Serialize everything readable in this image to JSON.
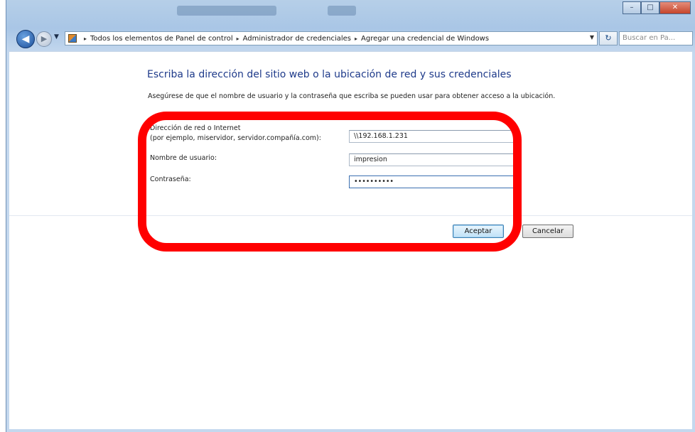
{
  "window": {
    "controls": {
      "minimize": "–",
      "maximize": "□",
      "close": "✕"
    }
  },
  "navbar": {
    "breadcrumbs": [
      "Todos los elementos de Panel de control",
      "Administrador de credenciales",
      "Agregar una credencial de Windows"
    ],
    "search_placeholder": "Buscar en Pa..."
  },
  "page": {
    "title": "Escriba la dirección del sitio web o la ubicación de red y sus credenciales",
    "description": "Asegúrese de que el nombre de usuario y la contraseña que escriba se pueden usar para obtener acceso a la ubicación."
  },
  "form": {
    "address_label": "Dirección de red o Internet",
    "address_hint": "(por ejemplo, miservidor, servidor.compañía.com):",
    "address_value": "\\\\192.168.1.231",
    "username_label": "Nombre de usuario:",
    "username_value": "impresion",
    "password_label": "Contraseña:",
    "password_value": "••••••••••"
  },
  "buttons": {
    "accept": "Aceptar",
    "cancel": "Cancelar"
  },
  "colors": {
    "highlight": "#ff0000",
    "title_text": "#1e3a8a"
  }
}
